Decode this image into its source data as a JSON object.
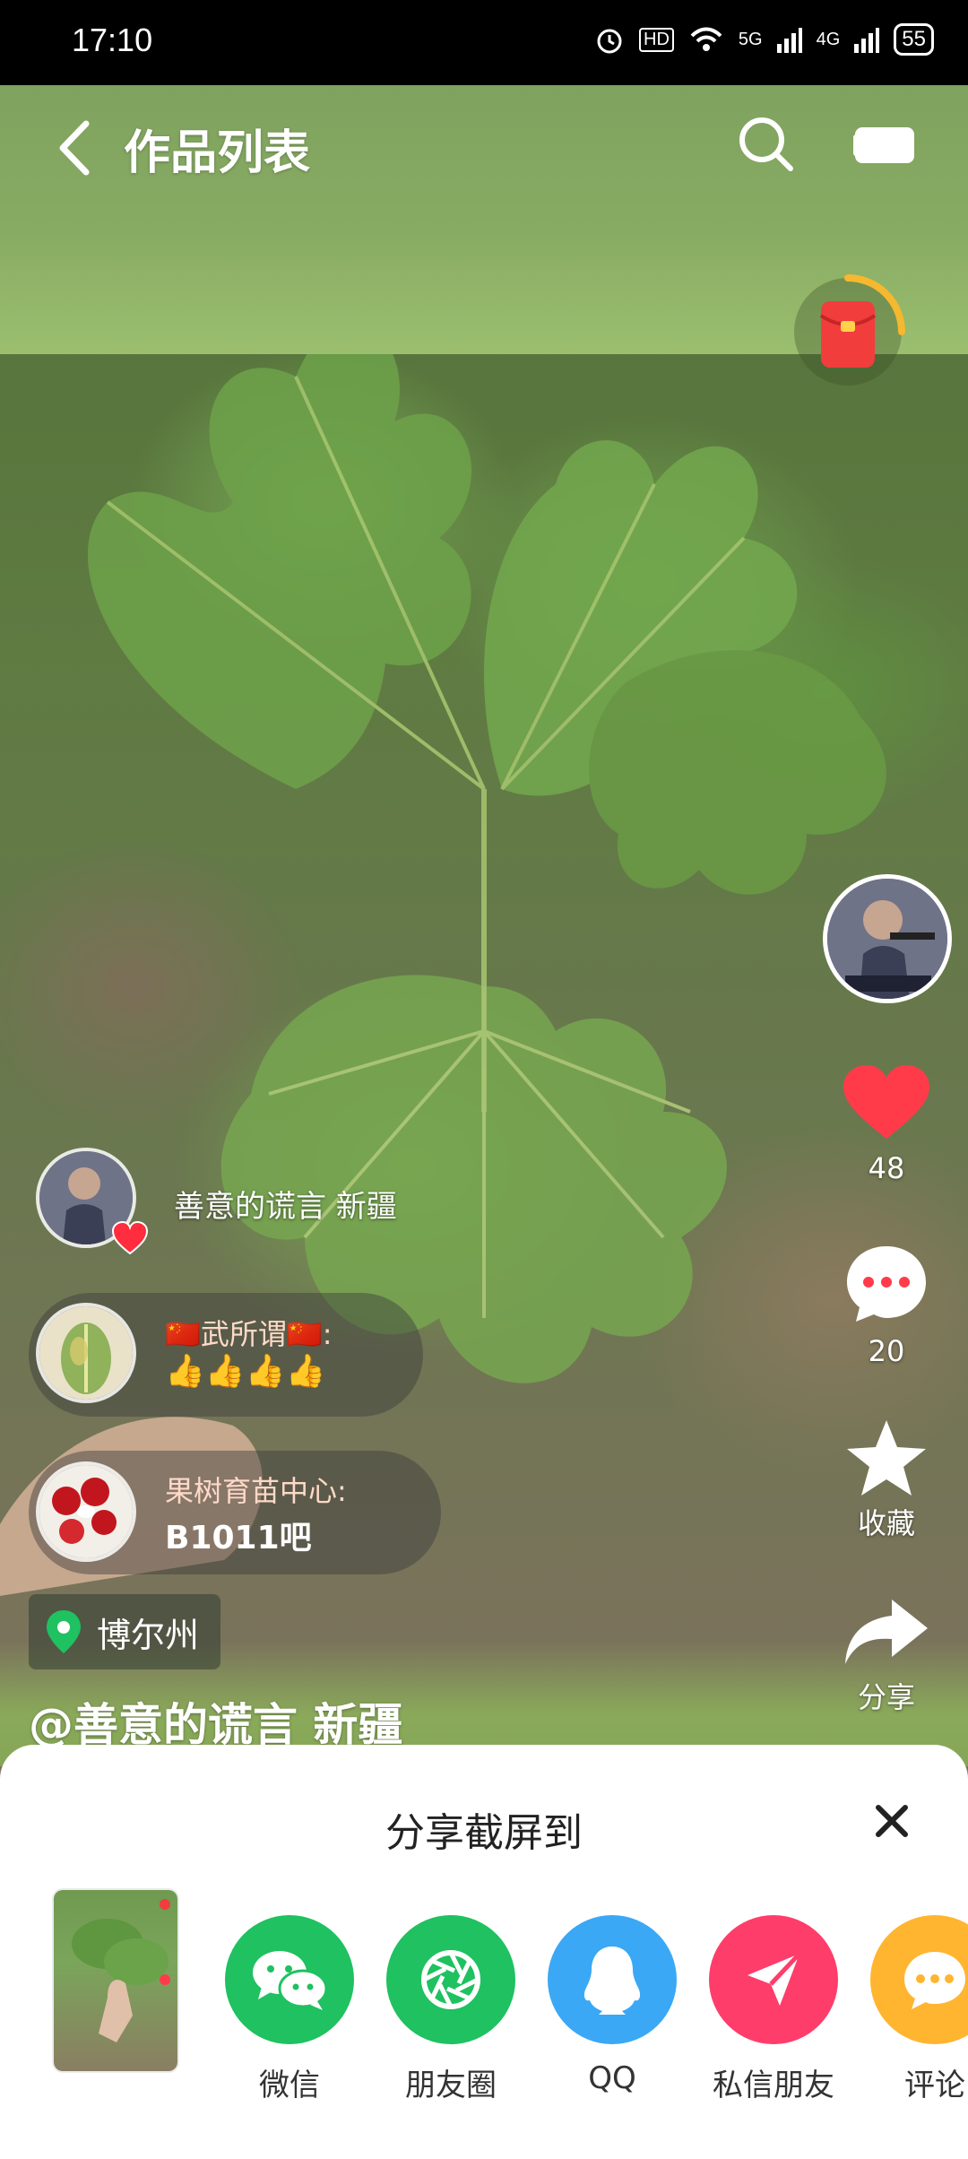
{
  "status_bar": {
    "time": "17:10",
    "hd": "HD",
    "net1": "5G",
    "net2": "4G",
    "battery": "55"
  },
  "header": {
    "title": "作品列表"
  },
  "right_rail": {
    "likes": "48",
    "comments": "20",
    "collect_label": "收藏",
    "share_label": "分享"
  },
  "comments": {
    "main_user": "善意的谎言 新疆",
    "items": [
      {
        "name": "🇨🇳武所谓🇨🇳:",
        "text": "👍👍👍👍"
      },
      {
        "name": "果树育苗中心:",
        "text": "B1011吧"
      }
    ]
  },
  "location": "博尔州",
  "author": "@善意的谎言 新疆",
  "share_sheet": {
    "title": "分享截屏到",
    "options": [
      {
        "label": "微信",
        "color": "#1fc160"
      },
      {
        "label": "朋友圈",
        "color": "#1fc160"
      },
      {
        "label": "QQ",
        "color": "#3aa8f5"
      },
      {
        "label": "私信朋友",
        "color": "#ff3d6a"
      },
      {
        "label": "评论",
        "color": "#ffb52f"
      }
    ]
  },
  "colors": {
    "like": "#ff3b4a",
    "red_packet": "#f23d3d",
    "ring": "#f5b82e"
  }
}
